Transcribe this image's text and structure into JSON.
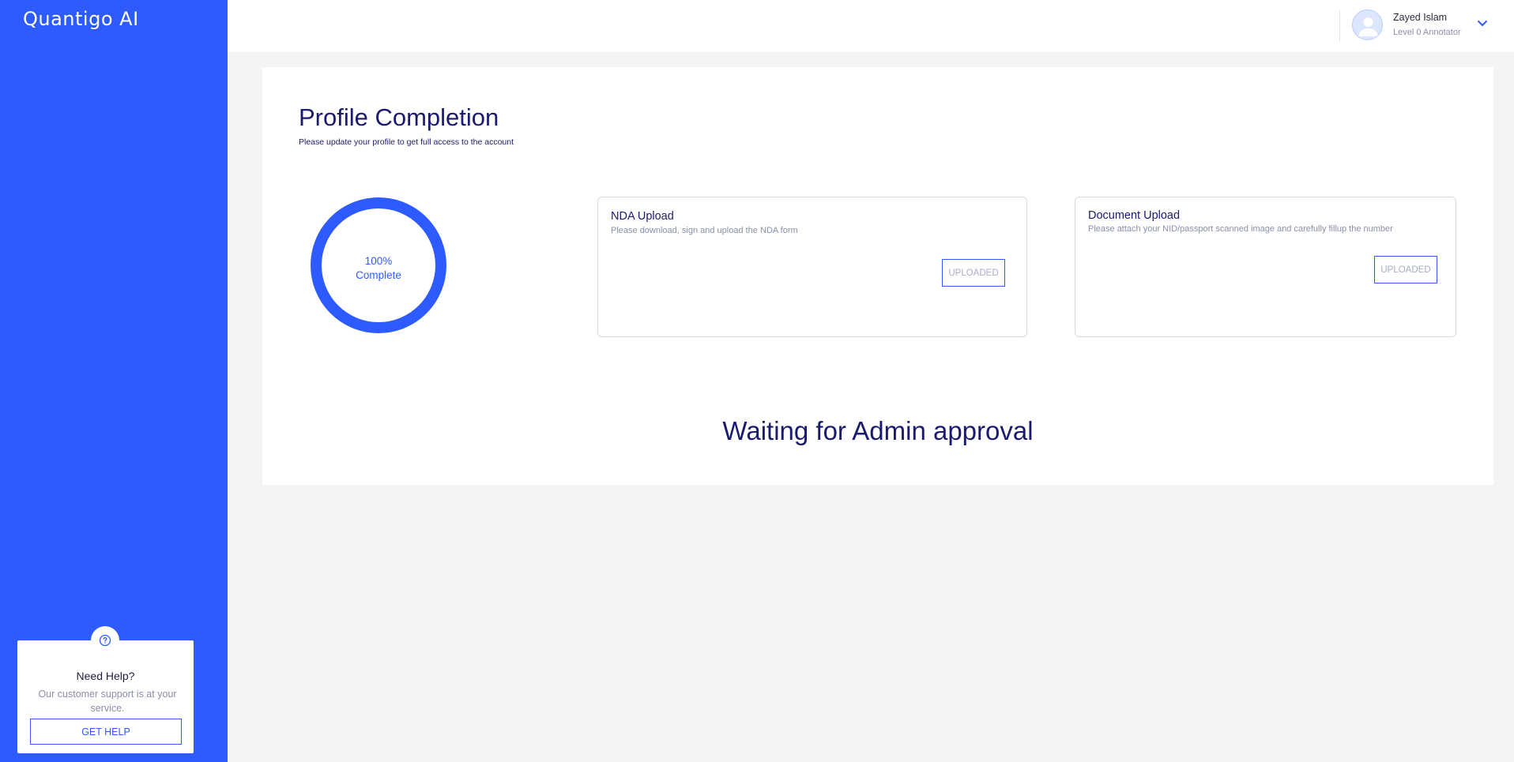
{
  "sidebar": {
    "brand": "Quantigo AI",
    "help": {
      "icon": "help-circle-icon",
      "title": "Need Help?",
      "text": "Our customer support is at your service.",
      "button_label": "GET HELP"
    }
  },
  "header": {
    "user": {
      "name": "Zayed Islam",
      "role": "Level 0 Annotator",
      "avatar_icon": "user-avatar-icon",
      "menu_icon": "chevron-down-icon"
    }
  },
  "main": {
    "title": "Profile Completion",
    "subtitle": "Please update your profile to get full access to the account",
    "progress": {
      "percent": 100,
      "percent_label": "100%",
      "status_label": "Complete"
    },
    "cards": [
      {
        "title": "NDA Upload",
        "description": "Please download, sign and upload the NDA form",
        "button_label": "UPLOADED"
      },
      {
        "title": "Document Upload",
        "description": "Please attach your NID/passport scanned image and carefully fillup the number",
        "button_label": "UPLOADED"
      }
    ],
    "status_message": "Waiting for Admin approval"
  },
  "colors": {
    "primary": "#2e5bff",
    "heading": "#1a1a6e",
    "muted": "#8a8fa6",
    "background": "#f4f4f4"
  }
}
